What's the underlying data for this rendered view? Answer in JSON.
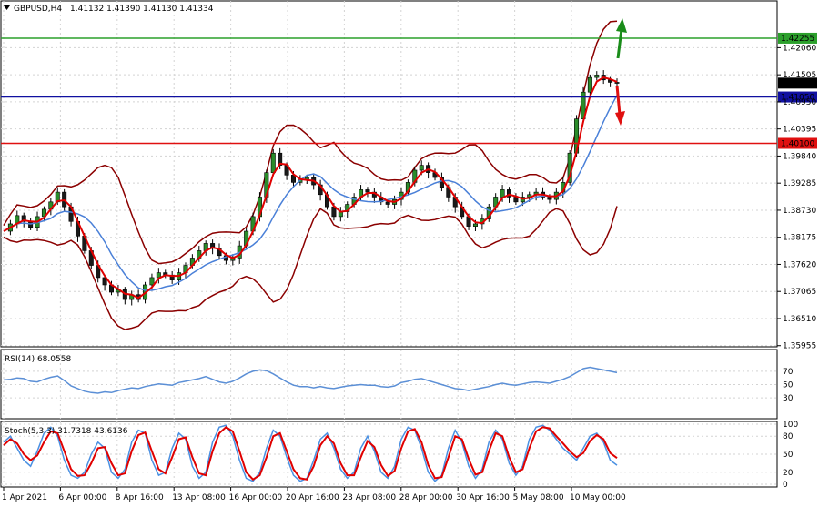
{
  "header": {
    "symbol": "GBPUSD,H4",
    "ohlc": "1.41132 1.41390 1.41130 1.41334"
  },
  "colors": {
    "background": "#ffffff",
    "grid": "#d3d3d3",
    "candle_bull": "#2a8c2a",
    "candle_bear": "#1a1a1a",
    "ma_fast": "#e00000",
    "ma_slow": "#4a80d8",
    "bands": "#8b0000",
    "level_green": "#2ca02c",
    "level_blue": "#1010a0",
    "level_red": "#e01010",
    "rsi_line": "#5b8fd6",
    "stoch_main": "#4a90e2",
    "stoch_signal": "#e00000",
    "price_tag": "#000000",
    "arrow_up": "#1a8c1a",
    "arrow_down": "#e01010"
  },
  "chart_data": [
    {
      "type": "candlestick",
      "title": "GBPUSD,H4",
      "ylim": [
        1.3595,
        1.43
      ],
      "y_ticks": [
        "1.42060",
        "1.41505",
        "1.40950",
        "1.40395",
        "1.39840",
        "1.39285",
        "1.38730",
        "1.38175",
        "1.37620",
        "1.37065",
        "1.36510",
        "1.35955"
      ],
      "x_tick_labels": [
        "1 Apr 2021",
        "6 Apr 00:00",
        "8 Apr 16:00",
        "13 Apr 08:00",
        "16 Apr 00:00",
        "20 Apr 16:00",
        "23 Apr 08:00",
        "28 Apr 00:00",
        "30 Apr 16:00",
        "5 May 08:00",
        "10 May 00:00"
      ],
      "price_close_series": [
        1.383,
        1.3845,
        1.3862,
        1.385,
        1.3838,
        1.386,
        1.3875,
        1.389,
        1.391,
        1.388,
        1.385,
        1.382,
        1.379,
        1.376,
        1.3735,
        1.372,
        1.3705,
        1.371,
        1.369,
        1.37,
        1.369,
        1.372,
        1.3735,
        1.3745,
        1.374,
        1.373,
        1.3745,
        1.376,
        1.3775,
        1.379,
        1.3805,
        1.3795,
        1.378,
        1.377,
        1.3775,
        1.38,
        1.383,
        1.386,
        1.39,
        1.395,
        1.399,
        1.3965,
        1.3945,
        1.393,
        1.3935,
        1.394,
        1.3925,
        1.3905,
        1.388,
        1.386,
        1.387,
        1.3885,
        1.39,
        1.3915,
        1.391,
        1.39,
        1.389,
        1.3885,
        1.3895,
        1.391,
        1.393,
        1.3955,
        1.3965,
        1.395,
        1.394,
        1.392,
        1.39,
        1.388,
        1.386,
        1.384,
        1.3845,
        1.3855,
        1.388,
        1.39,
        1.3915,
        1.39,
        1.389,
        1.39,
        1.3905,
        1.391,
        1.39,
        1.3895,
        1.391,
        1.393,
        1.399,
        1.406,
        1.4115,
        1.4145,
        1.415,
        1.414,
        1.4135,
        1.4133
      ],
      "levels": [
        {
          "value": 1.42255,
          "label": "1.42255",
          "color": "#2ca02c"
        },
        {
          "value": 1.4105,
          "label": "1.41050",
          "color": "#1010a0"
        },
        {
          "value": 1.401,
          "label": "1.40100",
          "color": "#e01010"
        }
      ],
      "current_price": "1.41334",
      "arrows": [
        "up",
        "down"
      ]
    },
    {
      "type": "line",
      "title": "RSI(14) 68.0558",
      "ylim": [
        0,
        100
      ],
      "y_ticks": [
        "70",
        "50",
        "30"
      ],
      "values": [
        57,
        58,
        60,
        59,
        55,
        54,
        58,
        61,
        63,
        56,
        48,
        44,
        40,
        38,
        37,
        39,
        38,
        41,
        43,
        45,
        44,
        47,
        49,
        51,
        50,
        49,
        53,
        55,
        57,
        59,
        62,
        58,
        54,
        52,
        55,
        60,
        66,
        70,
        72,
        71,
        66,
        60,
        54,
        49,
        47,
        47,
        45,
        47,
        45,
        44,
        46,
        48,
        49,
        50,
        49,
        49,
        47,
        46,
        48,
        53,
        55,
        58,
        59,
        56,
        53,
        50,
        47,
        44,
        43,
        41,
        43,
        45,
        47,
        50,
        52,
        50,
        49,
        51,
        53,
        54,
        53,
        52,
        55,
        58,
        62,
        68,
        74,
        76,
        74,
        72,
        70,
        68
      ]
    },
    {
      "type": "line",
      "title": "Stoch(5,3,3) 31.7318 43.6136",
      "ylim": [
        0,
        100
      ],
      "y_ticks": [
        "100",
        "80",
        "50",
        "20",
        "0"
      ],
      "series": [
        {
          "values": [
            70,
            80,
            60,
            40,
            30,
            55,
            85,
            95,
            80,
            40,
            15,
            10,
            20,
            50,
            70,
            60,
            20,
            10,
            25,
            70,
            90,
            85,
            40,
            15,
            20,
            60,
            85,
            75,
            30,
            10,
            20,
            70,
            95,
            98,
            80,
            40,
            10,
            5,
            20,
            60,
            90,
            80,
            45,
            15,
            5,
            10,
            40,
            75,
            85,
            60,
            25,
            10,
            20,
            60,
            80,
            55,
            20,
            10,
            30,
            75,
            95,
            90,
            60,
            20,
            5,
            15,
            60,
            90,
            70,
            30,
            10,
            25,
            70,
            90,
            75,
            35,
            15,
            30,
            75,
            95,
            98,
            90,
            75,
            60,
            50,
            40,
            60,
            80,
            85,
            70,
            40,
            31.7
          ]
        },
        {
          "values": [
            65,
            75,
            68,
            50,
            40,
            48,
            70,
            88,
            85,
            55,
            25,
            14,
            15,
            35,
            60,
            62,
            35,
            15,
            18,
            55,
            82,
            86,
            55,
            25,
            18,
            45,
            75,
            78,
            45,
            18,
            15,
            55,
            85,
            95,
            88,
            55,
            20,
            8,
            15,
            45,
            80,
            85,
            55,
            25,
            10,
            8,
            30,
            65,
            80,
            68,
            35,
            15,
            15,
            45,
            72,
            62,
            32,
            14,
            22,
            60,
            88,
            92,
            70,
            32,
            10,
            12,
            45,
            80,
            75,
            42,
            16,
            20,
            55,
            85,
            80,
            45,
            20,
            25,
            60,
            88,
            95,
            93,
            80,
            68,
            55,
            45,
            52,
            72,
            82,
            75,
            52,
            43.6
          ]
        }
      ]
    }
  ]
}
